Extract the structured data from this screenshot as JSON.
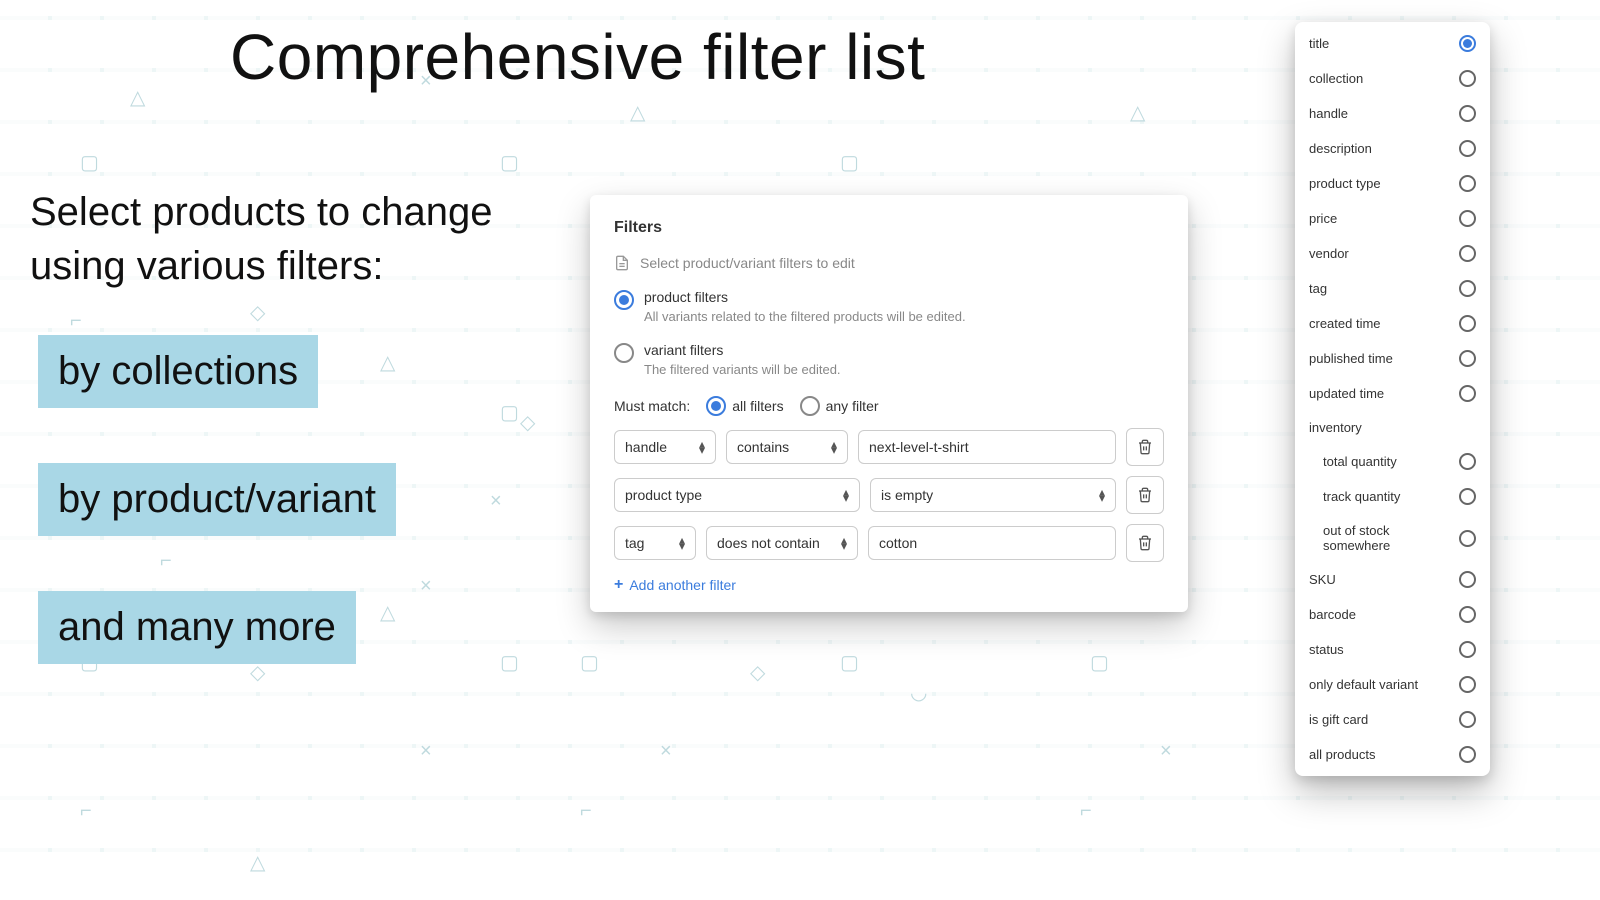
{
  "title": "Comprehensive filter list",
  "subtitle_line1": "Select products to change",
  "subtitle_line2": "using various filters:",
  "chips": {
    "collections": "by collections",
    "product_variant": "by product/variant",
    "many_more": "and many more"
  },
  "panel": {
    "title": "Filters",
    "hint": "Select product/variant filters to edit",
    "radios": {
      "product": {
        "label": "product filters",
        "desc": "All variants related to the filtered products will be edited."
      },
      "variant": {
        "label": "variant filters",
        "desc": "The filtered variants will be edited."
      }
    },
    "match": {
      "label": "Must match:",
      "all": "all filters",
      "any": "any filter"
    },
    "rows": [
      {
        "field": "handle",
        "op": "contains",
        "value": "next-level-t-shirt"
      },
      {
        "field": "product type",
        "op": "is empty",
        "value": ""
      },
      {
        "field": "tag",
        "op": "does not contain",
        "value": "cotton"
      }
    ],
    "add": "Add another filter"
  },
  "filter_list": [
    {
      "label": "title",
      "selected": true
    },
    {
      "label": "collection"
    },
    {
      "label": "handle"
    },
    {
      "label": "description"
    },
    {
      "label": "product type"
    },
    {
      "label": "price"
    },
    {
      "label": "vendor"
    },
    {
      "label": "tag"
    },
    {
      "label": "created time"
    },
    {
      "label": "published time"
    },
    {
      "label": "updated time"
    },
    {
      "label": "inventory",
      "is_header": true
    },
    {
      "label": "total quantity",
      "indent": true
    },
    {
      "label": "track quantity",
      "indent": true
    },
    {
      "label": "out of stock somewhere",
      "indent": true
    },
    {
      "label": "SKU"
    },
    {
      "label": "barcode"
    },
    {
      "label": "status"
    },
    {
      "label": "only default variant"
    },
    {
      "label": "is gift card"
    },
    {
      "label": "all products"
    }
  ]
}
